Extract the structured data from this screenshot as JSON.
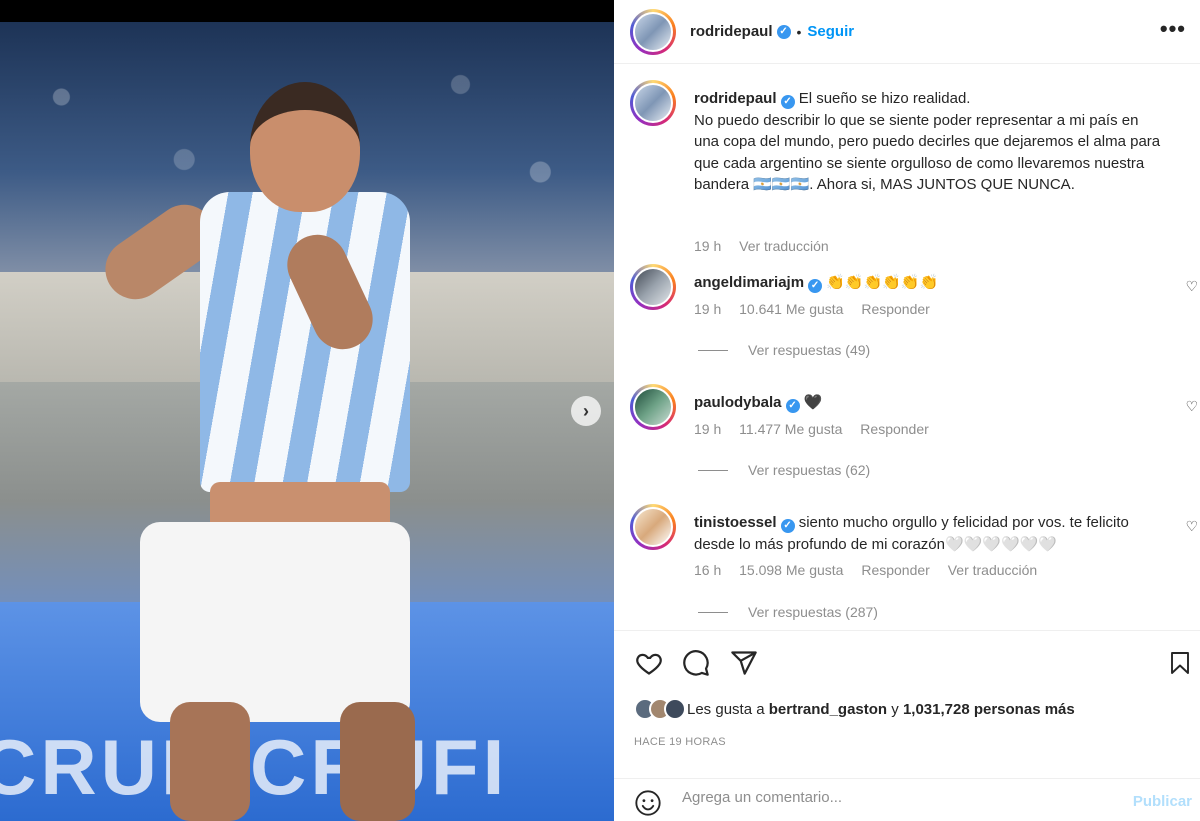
{
  "post": {
    "author": "rodridepaul",
    "follow_label": "Seguir",
    "more_label": "•••",
    "separator": "•"
  },
  "caption": {
    "username": "rodridepaul",
    "text_first": "El sueño se hizo realidad.",
    "text_body": "No puedo describir lo que se siente poder representar a mi país en una copa del mundo, pero puedo decirles que dejaremos el alma para que cada argentino se siente orgulloso de como llevaremos nuestra bandera 🇦🇷🇦🇷🇦🇷. Ahora si, MAS JUNTOS QUE NUNCA.",
    "time": "19 h",
    "translate": "Ver traducción"
  },
  "comments": [
    {
      "username": "angeldimariajm",
      "text": "👏👏👏👏👏👏",
      "time": "19 h",
      "likes": "10.641 Me gusta",
      "reply": "Responder",
      "view_replies": "Ver respuestas (49)"
    },
    {
      "username": "paulodybala",
      "text": "🖤",
      "time": "19 h",
      "likes": "11.477 Me gusta",
      "reply": "Responder",
      "view_replies": "Ver respuestas (62)"
    },
    {
      "username": "tinistoessel",
      "text": "siento mucho orgullo y felicidad por vos. te felicito desde lo más profundo de mi corazón🤍🤍🤍🤍🤍🤍",
      "time": "16 h",
      "likes": "15.098 Me gusta",
      "reply": "Responder",
      "translate": "Ver traducción",
      "view_replies": "Ver respuestas (287)"
    }
  ],
  "likes_line": {
    "prefix": "Les gusta a",
    "user": "bertrand_gaston",
    "connector": "y",
    "count": "1,031,728 personas más"
  },
  "time_ago": "HACE 19 HORAS",
  "add_comment": {
    "placeholder": "Agrega un comentario...",
    "publish": "Publicar"
  },
  "photo": {
    "board_text": "CRUFI"
  },
  "icons": {
    "like": "heart-icon",
    "comment": "comment-icon",
    "share": "share-icon",
    "save": "bookmark-icon",
    "emoji": "emoji-icon",
    "next": "chevron-right-icon",
    "verified": "verified-badge-icon"
  },
  "colors": {
    "link_blue": "#0095f6",
    "verified_blue": "#3897f0",
    "muted": "#8e8e8e",
    "publish_disabled": "#b2dffc"
  }
}
